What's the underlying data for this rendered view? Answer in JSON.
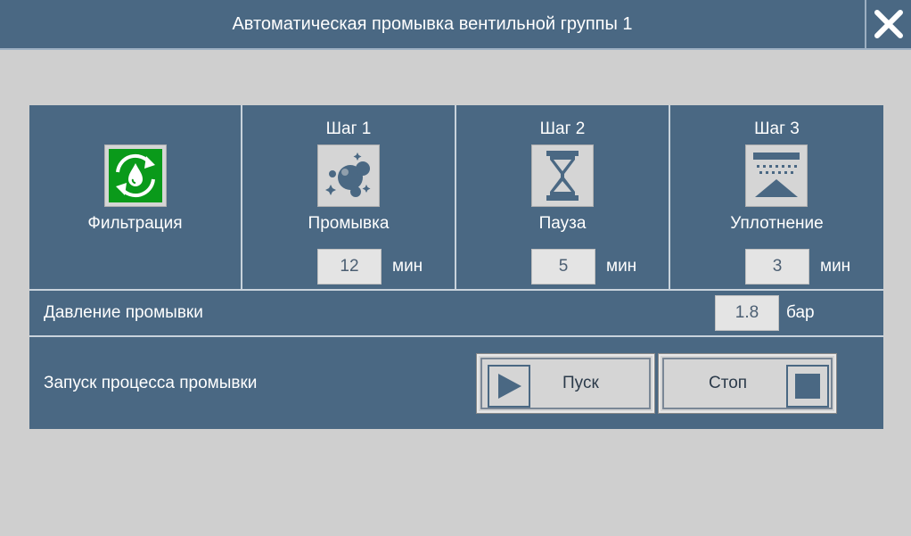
{
  "window": {
    "title": "Автоматическая промывка вентильной группы 1"
  },
  "filtration": {
    "label": "Фильтрация",
    "icon": "recycle-droplet-icon",
    "icon_color": "#0a9a1a"
  },
  "steps": [
    {
      "title": "Шаг 1",
      "label": "Промывка",
      "icon": "bubbles-icon",
      "value": "12",
      "unit": "мин"
    },
    {
      "title": "Шаг 2",
      "label": "Пауза",
      "icon": "hourglass-icon",
      "value": "5",
      "unit": "мин"
    },
    {
      "title": "Шаг 3",
      "label": "Уплотнение",
      "icon": "settling-icon",
      "value": "3",
      "unit": "мин"
    }
  ],
  "pressure": {
    "label": "Давление промывки",
    "value": "1.8",
    "unit": "бар"
  },
  "launch": {
    "label": "Запуск процесса промывки",
    "start_label": "Пуск",
    "stop_label": "Стоп"
  },
  "colors": {
    "panel": "#4a6883",
    "background": "#cfcfcf",
    "accent_green": "#0a9a1a"
  }
}
